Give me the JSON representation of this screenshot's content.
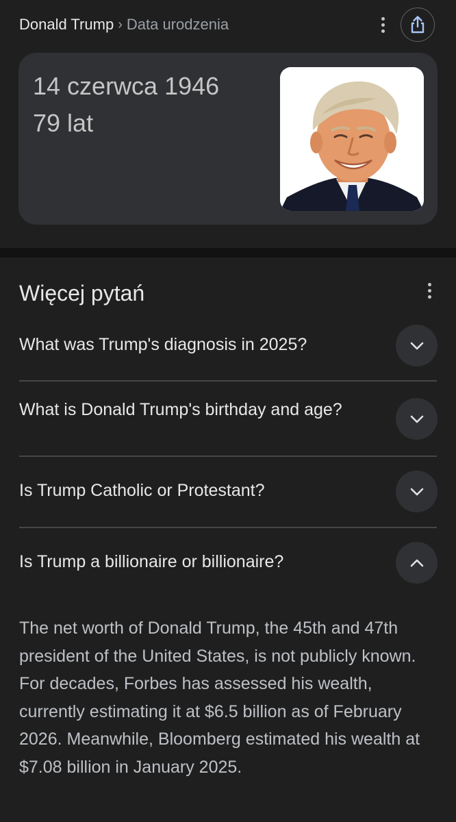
{
  "header": {
    "breadcrumb_main": "Donald Trump",
    "breadcrumb_separator": "›",
    "breadcrumb_sub": "Data urodzenia",
    "more_icon": "more-vert-icon",
    "share_icon": "share-icon"
  },
  "answer_card": {
    "birth_date": "14 czerwca 1946",
    "age": "79 lat",
    "image_subject": "portrait-photo"
  },
  "questions": {
    "title": "Więcej pytań",
    "items": [
      {
        "question": "What was Trump's diagnosis in 2025?",
        "expanded": false,
        "icon": "chevron-down-icon"
      },
      {
        "question": "What is Donald Trump's birthday and age?",
        "expanded": false,
        "icon": "chevron-down-icon"
      },
      {
        "question": "Is Trump Catholic or Protestant?",
        "expanded": false,
        "icon": "chevron-down-icon"
      },
      {
        "question": "Is Trump a billionaire or billionaire?",
        "expanded": true,
        "icon": "chevron-up-icon"
      }
    ],
    "expanded_answer": "The net worth of Donald Trump, the 45th and 47th president of the United States, is not publicly known. For decades, Forbes has assessed his wealth, currently estimating it at $6.5 billion as of February 2026. Meanwhile, Bloomberg estimated his wealth at $7.08 billion in January 2025."
  },
  "colors": {
    "background": "#1f1f1f",
    "card": "#303134",
    "text_primary": "#e8e8e8",
    "text_secondary": "#9aa0a6",
    "divider": "#444746"
  }
}
